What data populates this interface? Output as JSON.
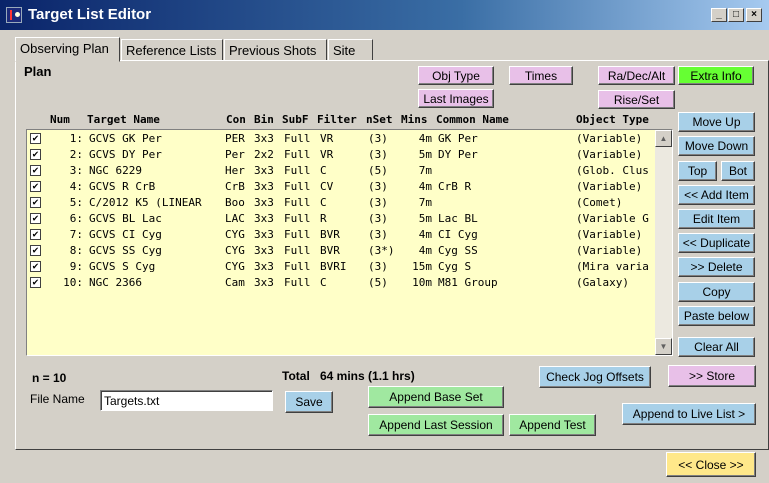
{
  "window": {
    "title": "Target List Editor"
  },
  "tabs": [
    "Observing Plan",
    "Reference Lists",
    "Previous Shots",
    "Site"
  ],
  "plan_label": "Plan",
  "top_buttons": {
    "obj_type": "Obj Type",
    "times": "Times",
    "ra_dec_alt": "Ra/Dec/Alt",
    "extra_info": "Extra Info",
    "last_images": "Last Images",
    "rise_set": "Rise/Set"
  },
  "columns": {
    "num": "Num",
    "target": "Target Name",
    "con": "Con",
    "bin": "Bin",
    "subf": "SubF",
    "filter": "Filter",
    "nset": "nSet",
    "mins": "Mins",
    "common": "Common Name",
    "type": "Object Type"
  },
  "rows": [
    {
      "checked": "✔",
      "num": "1:",
      "target": "GCVS GK Per",
      "con": "PER",
      "bin": "3x3",
      "subf": "Full",
      "filter": "VR",
      "nset": "(3)",
      "mins": "4m",
      "common": "GK Per",
      "type": "(Variable)"
    },
    {
      "checked": "✔",
      "num": "2:",
      "target": "GCVS DY Per",
      "con": "Per",
      "bin": "2x2",
      "subf": "Full",
      "filter": "VR",
      "nset": "(3)",
      "mins": "5m",
      "common": "DY Per",
      "type": "(Variable)"
    },
    {
      "checked": "✔",
      "num": "3:",
      "target": "NGC 6229",
      "con": "Her",
      "bin": "3x3",
      "subf": "Full",
      "filter": "C",
      "nset": "(5)",
      "mins": "7m",
      "common": "",
      "type": "(Glob. Clus"
    },
    {
      "checked": "✔",
      "num": "4:",
      "target": "GCVS R CrB",
      "con": "CrB",
      "bin": "3x3",
      "subf": "Full",
      "filter": "CV",
      "nset": "(3)",
      "mins": "4m",
      "common": "CrB R",
      "type": "(Variable)"
    },
    {
      "checked": "✔",
      "num": "5:",
      "target": "C/2012 K5 (LINEAR",
      "con": "Boo",
      "bin": "3x3",
      "subf": "Full",
      "filter": "C",
      "nset": "(3)",
      "mins": "7m",
      "common": "",
      "type": "(Comet)"
    },
    {
      "checked": "✔",
      "num": "6:",
      "target": "GCVS BL Lac",
      "con": "LAC",
      "bin": "3x3",
      "subf": "Full",
      "filter": "R",
      "nset": "(3)",
      "mins": "5m",
      "common": "Lac BL",
      "type": "(Variable G"
    },
    {
      "checked": "✔",
      "num": "7:",
      "target": "GCVS CI Cyg",
      "con": "CYG",
      "bin": "3x3",
      "subf": "Full",
      "filter": "BVR",
      "nset": "(3)",
      "mins": "4m",
      "common": "CI Cyg",
      "type": "(Variable)"
    },
    {
      "checked": "✔",
      "num": "8:",
      "target": "GCVS SS Cyg",
      "con": "CYG",
      "bin": "3x3",
      "subf": "Full",
      "filter": "BVR",
      "nset": "(3*)",
      "mins": "4m",
      "common": "Cyg SS",
      "type": "(Variable)"
    },
    {
      "checked": "✔",
      "num": "9:",
      "target": "GCVS S Cyg",
      "con": "CYG",
      "bin": "3x3",
      "subf": "Full",
      "filter": "BVRI",
      "nset": "(3)",
      "mins": "15m",
      "common": "Cyg S",
      "type": "(Mira varia"
    },
    {
      "checked": "✔",
      "num": "10:",
      "target": "NGC 2366",
      "con": "Cam",
      "bin": "3x3",
      "subf": "Full",
      "filter": "C",
      "nset": "(5)",
      "mins": "10m",
      "common": "M81 Group",
      "type": "(Galaxy)"
    }
  ],
  "side_buttons": {
    "move_up": "Move Up",
    "move_down": "Move Down",
    "top": "Top",
    "bot": "Bot",
    "add_item": "<< Add Item",
    "edit_item": "Edit Item",
    "duplicate": "<< Duplicate",
    "delete": ">> Delete",
    "copy": "Copy",
    "paste_below": "Paste below",
    "clear_all": "Clear All",
    "store": ">> Store",
    "append_live": "Append to Live List >"
  },
  "bottom": {
    "count": "n = 10",
    "total_label": "Total",
    "total_value": "64 mins (1.1 hrs)",
    "file_name_label": "File Name",
    "file_name_value": "Targets.txt",
    "save": "Save",
    "check_jog": "Check Jog Offsets",
    "append_base": "Append Base Set",
    "append_last": "Append Last Session",
    "append_test": "Append Test",
    "close": "<< Close >>"
  },
  "icons": {
    "scroll_up": "▲",
    "scroll_down": "▼",
    "minimize": "_",
    "maximize": "□",
    "close": "×"
  },
  "colors": {
    "list_bg": "#ffffc8",
    "pink": "#e8c0e8",
    "blue": "#a8d0e8",
    "green": "#a0e8a0",
    "lime": "#66ff33",
    "yellow": "#ffe88a"
  }
}
